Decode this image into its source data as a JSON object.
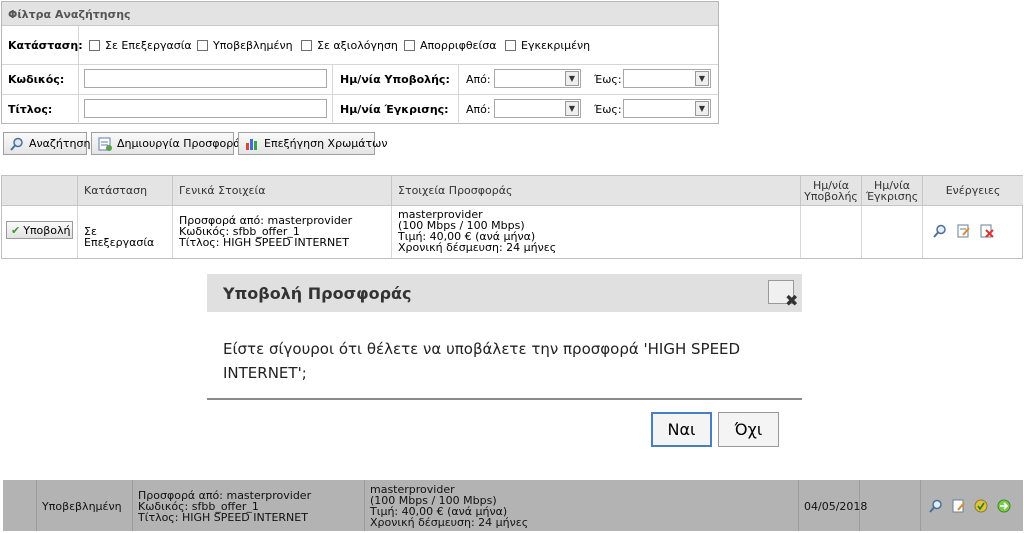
{
  "filters": {
    "title": "Φίλτρα Αναζήτησης",
    "status_label": "Κατάσταση:",
    "status_options": [
      "Σε Επεξεργασία",
      "Υποβεβλημένη",
      "Σε αξιολόγηση",
      "Απορριφθείσα",
      "Εγκεκριμένη"
    ],
    "code_label": "Κωδικός:",
    "title_label": "Τίτλος:",
    "submit_date_label": "Ημ/νία Υποβολής:",
    "approve_date_label": "Ημ/νία Έγκρισης:",
    "from_label": "Από:",
    "to_label": "Έως:"
  },
  "toolbar": {
    "search": "Αναζήτηση",
    "create": "Δημιουργία Προσφοράς",
    "colors": "Επεξήγηση Χρωμάτων"
  },
  "table": {
    "headers": {
      "status": "Κατάσταση",
      "general": "Γενικά Στοιχεία",
      "offer": "Στοιχεία Προσφοράς",
      "submit_date": "Ημ/νία Υποβολής",
      "approve_date": "Ημ/νία Έγκρισης",
      "actions": "Ενέργειες"
    },
    "row1": {
      "submit_button": "Υποβολή",
      "status": "Σε Επεξεργασία",
      "general": [
        "Προσφορά από: masterprovider",
        "Κωδικός: sfbb_offer_1",
        "Τίτλος: HIGH SPEED INTERNET"
      ],
      "offer": [
        "masterprovider",
        "(100 Mbps / 100 Mbps)",
        "Τιμή: 40,00 € (ανά μήνα)",
        "Χρονική δέσμευση: 24 μήνες"
      ]
    },
    "row2": {
      "status": "Υποβεβλημένη",
      "general": [
        "Προσφορά από: masterprovider",
        "Κωδικός: sfbb_offer_1",
        "Τίτλος: HIGH SPEED INTERNET"
      ],
      "offer": [
        "masterprovider",
        "(100 Mbps / 100 Mbps)",
        "Τιμή: 40,00 € (ανά μήνα)",
        "Χρονική δέσμευση: 24 μήνες"
      ],
      "submit_date": "04/05/2018"
    }
  },
  "dialog": {
    "title": "Υποβολή Προσφοράς",
    "message": "Είστε σίγουροι ότι θέλετε να υποβάλετε την προσφορά 'HIGH SPEED INTERNET';",
    "yes": "Ναι",
    "no": "Όχι"
  },
  "colors": {
    "header_bg": "#e3e3e3",
    "dark_row": "#b3b3b3"
  }
}
